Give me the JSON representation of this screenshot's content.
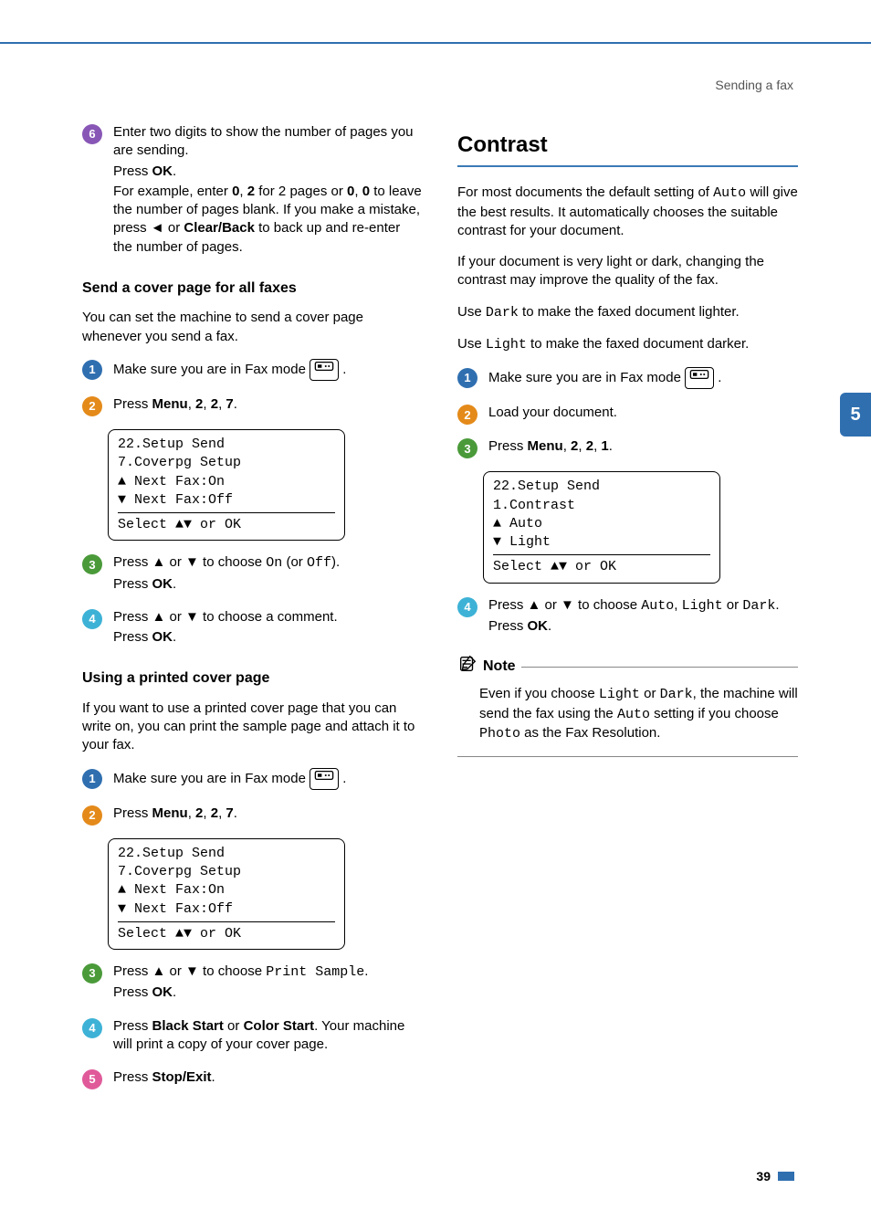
{
  "header": {
    "section": "Sending a fax"
  },
  "tab": {
    "chapter": "5"
  },
  "left": {
    "stepA6": {
      "p1_a": "Enter two digits to show the number of pages you are sending.",
      "p1_b_a": "Press ",
      "p1_b_b": "OK",
      "p1_b_c": ".",
      "p2_a": "For example, enter ",
      "p2_b": "0",
      "p2_c": ", ",
      "p2_d": "2",
      "p2_e": " for 2 pages or ",
      "p2_f": "0",
      "p2_g": ", ",
      "p3_a": "0",
      "p3_b": " to leave the number of pages blank. If you make a mistake, press ◄ or ",
      "p4_a": "Clear/Back",
      "p4_b": " to back up and re-enter the number of pages."
    },
    "sub1": "Send a cover page for all faxes",
    "sub1_intro": "You can set the machine to send a cover page whenever you send a fax.",
    "s1": {
      "txt": "Make sure you are in Fax mode "
    },
    "s2": {
      "a": "Press ",
      "b": "Menu",
      "c": ", ",
      "d": "2",
      "e": ", ",
      "f": "2",
      "g": ", ",
      "h": "7",
      "i": "."
    },
    "lcd1": {
      "l1": "22.Setup Send",
      "l2": "  7.Coverpg Setup",
      "l3": "▲    Next Fax:On",
      "l4": "▼    Next Fax:Off",
      "l5": "Select ▲▼ or OK"
    },
    "s3": {
      "a": "Press ▲ or ▼ to choose ",
      "on": "On",
      "mid": " (or ",
      "off": "Off",
      "end": ").",
      "ok_a": "Press ",
      "ok_b": "OK",
      "ok_c": "."
    },
    "s4": {
      "a": "Press ▲ or ▼ to choose a comment.",
      "ok_a": "Press ",
      "ok_b": "OK",
      "ok_c": "."
    },
    "sub2": "Using a printed cover page",
    "sub2_intro": "If you want to use a printed cover page that you can write on, you can print the sample page and attach it to your fax.",
    "u1": {
      "txt": "Make sure you are in Fax mode "
    },
    "u2": {
      "a": "Press ",
      "b": "Menu",
      "c": ", ",
      "d": "2",
      "e": ", ",
      "f": "2",
      "g": ", ",
      "h": "7",
      "i": "."
    },
    "lcd2": {
      "l1": "22.Setup Send",
      "l2": "  7.Coverpg Setup",
      "l3": "▲    Next Fax:On",
      "l4": "▼    Next Fax:Off",
      "l5": "Select ▲▼ or OK"
    },
    "u3": {
      "a": "Press ▲ or ▼ to choose ",
      "ps": "Print Sample",
      "end": ".",
      "ok_a": "Press ",
      "ok_b": "OK",
      "ok_c": "."
    },
    "u4": {
      "a": "Press ",
      "bs": "Black Start",
      "b": " or ",
      "cs": "Color Start",
      "c": ". Your machine will print a copy of your cover page."
    },
    "u5": {
      "a": "Press ",
      "se": "Stop/Exit",
      "b": "."
    }
  },
  "right": {
    "h2": "Contrast",
    "p1_a": "For most documents the default setting of ",
    "p1_auto": "Auto",
    "p1_b": " will give the best results. It automatically chooses the suitable contrast for your document.",
    "p2": "If your document is very light or dark, changing the contrast may improve the quality of the fax.",
    "p3_a": "Use ",
    "p3_dark": "Dark",
    "p3_b": " to make the faxed document lighter.",
    "p4_a": "Use ",
    "p4_light": "Light",
    "p4_b": " to make the faxed document darker.",
    "r1": {
      "txt": "Make sure you are in Fax mode "
    },
    "r2": {
      "txt": "Load your document."
    },
    "r3": {
      "a": "Press ",
      "b": "Menu",
      "c": ", ",
      "d": "2",
      "e": ", ",
      "f": "2",
      "g": ", ",
      "h": "1",
      "i": "."
    },
    "lcd": {
      "l1": "22.Setup Send",
      "l2": "  1.Contrast",
      "l3": "▲    Auto",
      "l4": "▼    Light",
      "l5": "Select ▲▼ or OK"
    },
    "r4": {
      "a": "Press ▲ or ▼ to choose ",
      "auto": "Auto",
      "c1": ", ",
      "light": "Light",
      "or": " or ",
      "dark": "Dark",
      "end": ".",
      "ok_a": "Press ",
      "ok_b": "OK",
      "ok_c": "."
    },
    "note_label": "Note",
    "note_a": "Even if you choose ",
    "note_light": "Light",
    "note_b": " or ",
    "note_dark": "Dark",
    "note_c": ", the machine will send the fax using the ",
    "note_auto": "Auto",
    "note_d": " setting if you choose ",
    "note_photo": "Photo",
    "note_e": " as the Fax Resolution."
  },
  "footer": {
    "page": "39"
  }
}
